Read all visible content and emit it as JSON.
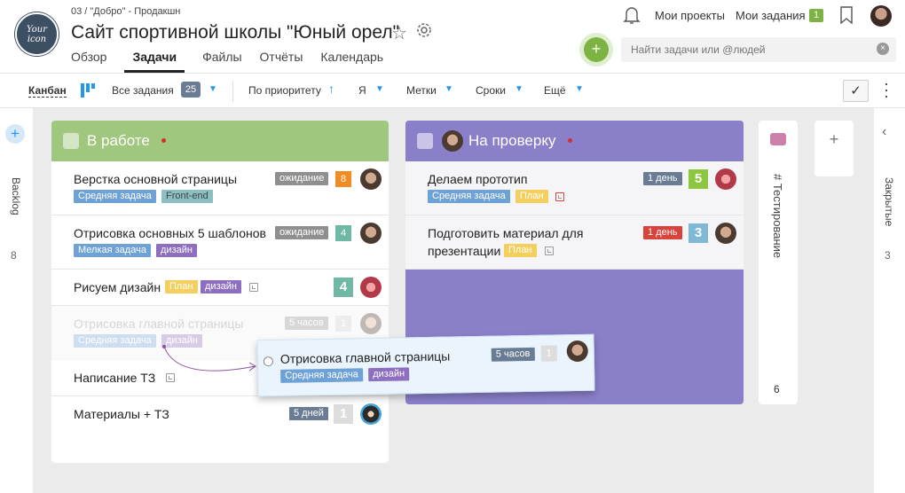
{
  "header": {
    "logo_text": "Your icon",
    "breadcrumb": "03 / \"Добро\" - Продакшн",
    "title": "Сайт спортивной школы \"Юный орел\"",
    "nav": [
      "Обзор",
      "Задачи",
      "Файлы",
      "Отчёты",
      "Календарь"
    ],
    "active_nav": "Задачи",
    "my_projects": "Мои проекты",
    "my_tasks": "Мои задания",
    "my_tasks_count": "1",
    "search_placeholder": "Найти задачи или @людей"
  },
  "toolbar": {
    "kanban": "Канбан",
    "all_tasks": "Все задания",
    "all_tasks_count": "25",
    "priority": "По приоритету",
    "me": "Я",
    "tags": "Метки",
    "deadlines": "Сроки",
    "more": "Ещё"
  },
  "sidebar_left": {
    "label": "Backlog",
    "count": "8"
  },
  "sidebar_right": {
    "label": "Закрытые",
    "count": "3"
  },
  "columns": [
    {
      "title": "В работе",
      "cards": [
        {
          "title": "Верстка основной страницы",
          "tags": [
            "Средняя задача",
            "Front-end"
          ],
          "status": "ожидание",
          "num": "8"
        },
        {
          "title": "Отрисовка основных 5 шаблонов",
          "tags": [
            "Мелкая задача",
            "дизайн"
          ],
          "status": "ожидание",
          "num": "4"
        },
        {
          "title": "Рисуем дизайн",
          "tags": [
            "План",
            "дизайн"
          ],
          "num": "4"
        },
        {
          "title": "Отрисовка главной страницы",
          "tags": [
            "Средняя задача",
            "дизайн"
          ],
          "status": "5 часов",
          "num": "1"
        },
        {
          "title": "Написание ТЗ"
        },
        {
          "title": "Материалы + ТЗ",
          "status": "5 дней",
          "num": "1"
        }
      ]
    },
    {
      "title": "На проверку",
      "cards": [
        {
          "title": "Делаем прототип",
          "tags": [
            "Средняя задача",
            "План"
          ],
          "status": "1 день",
          "num": "5"
        },
        {
          "title": "Подготовить материал для",
          "title2": "презентации",
          "tags": [
            "План"
          ],
          "status": "1 день",
          "num": "3"
        }
      ]
    },
    {
      "title": "# Тестирование",
      "count": "6"
    }
  ],
  "drag_card": {
    "title": "Отрисовка главной страницы",
    "tags": [
      "Средняя задача",
      "дизайн"
    ],
    "status": "5 часов",
    "num": "1"
  },
  "colors": {
    "green": "#9fc77e",
    "purple": "#8a7fc9",
    "accent": "#7cb342",
    "blue": "#2196f3"
  }
}
